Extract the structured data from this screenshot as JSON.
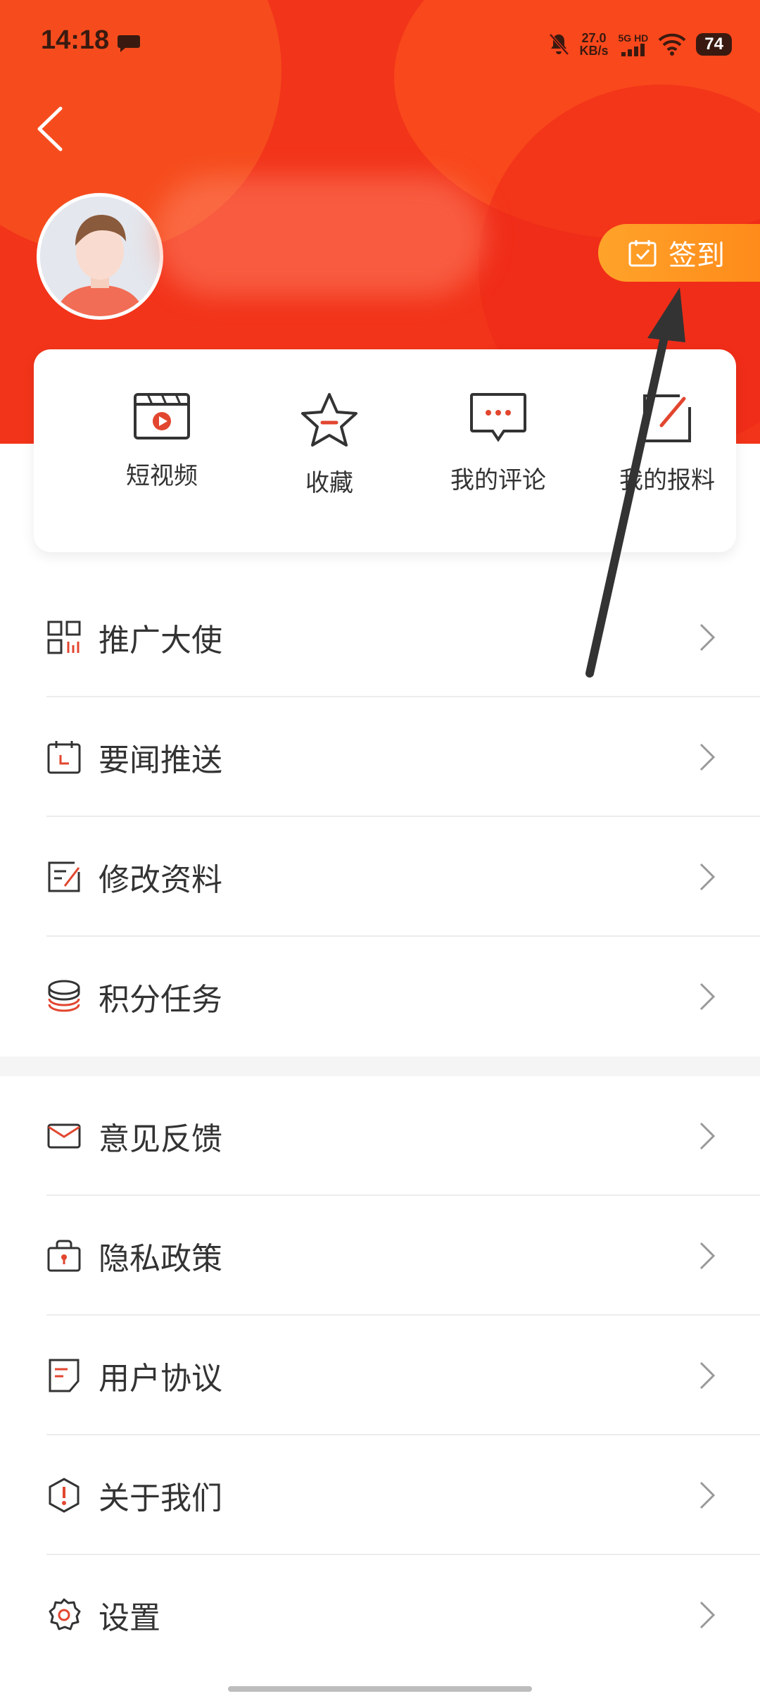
{
  "status_bar": {
    "time": "14:18",
    "net_speed_value": "27.0",
    "net_speed_unit": "KB/s",
    "network": "5G HD",
    "battery": "74"
  },
  "header": {
    "signin_label": "签到"
  },
  "quick_actions": [
    {
      "label": "短视频",
      "icon": "video-icon"
    },
    {
      "label": "收藏",
      "icon": "star-icon"
    },
    {
      "label": "我的评论",
      "icon": "comment-icon"
    },
    {
      "label": "我的报料",
      "icon": "edit-icon"
    }
  ],
  "menu_group_1": [
    {
      "label": "推广大使",
      "icon": "grid-icon"
    },
    {
      "label": "要闻推送",
      "icon": "calendar-icon"
    },
    {
      "label": "修改资料",
      "icon": "edit-profile-icon"
    },
    {
      "label": "积分任务",
      "icon": "coins-icon"
    }
  ],
  "menu_group_2": [
    {
      "label": "意见反馈",
      "icon": "mail-icon"
    },
    {
      "label": "隐私政策",
      "icon": "lock-icon"
    },
    {
      "label": "用户协议",
      "icon": "document-icon"
    },
    {
      "label": "关于我们",
      "icon": "info-icon"
    },
    {
      "label": "设置",
      "icon": "gear-icon"
    }
  ],
  "colors": {
    "header_red": "#f2341a",
    "accent_orange": "#ff9a22",
    "icon_red": "#e2462f",
    "icon_dark": "#333333"
  }
}
